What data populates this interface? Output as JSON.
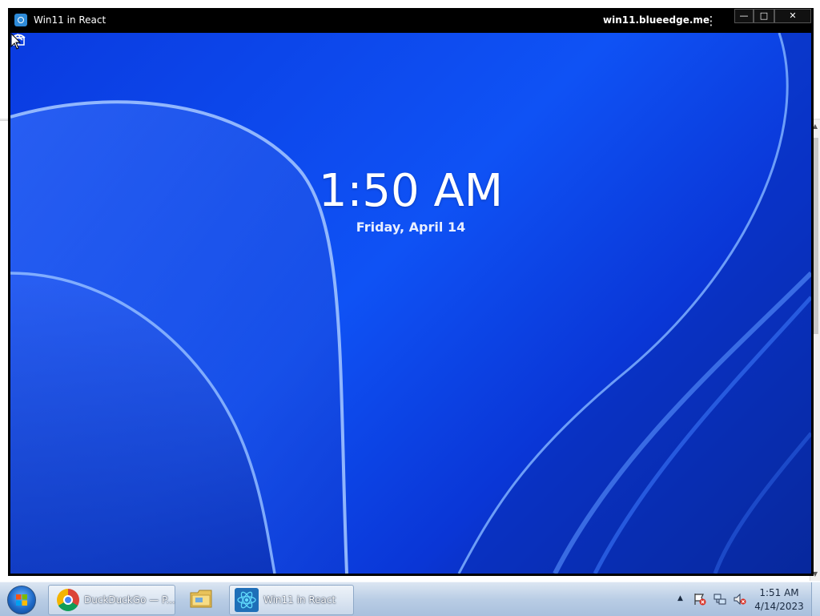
{
  "window": {
    "title": "Win11 in React",
    "url": "win11.blueedge.me",
    "menu_icon": "kebab-icon",
    "controls": {
      "minimize": "—",
      "maximize": "□",
      "close": "✕"
    }
  },
  "lockscreen": {
    "time": "1:50 AM",
    "date": "Friday, April 14",
    "status_icons": [
      "wifi-icon",
      "battery-icon"
    ]
  },
  "taskbar": {
    "items": [
      {
        "label": "DuckDuckGo — P...",
        "icon": "chrome-icon"
      },
      {
        "label": "",
        "icon": "folder-icon"
      },
      {
        "label": "Win11 in React",
        "icon": "react-icon"
      }
    ],
    "clock": {
      "time": "1:51 AM",
      "date": "4/14/2023"
    }
  },
  "colors": {
    "wallpaper_primary": "#0f52f5",
    "wallpaper_dark": "#06207a",
    "taskbar": "#b9cde5"
  }
}
